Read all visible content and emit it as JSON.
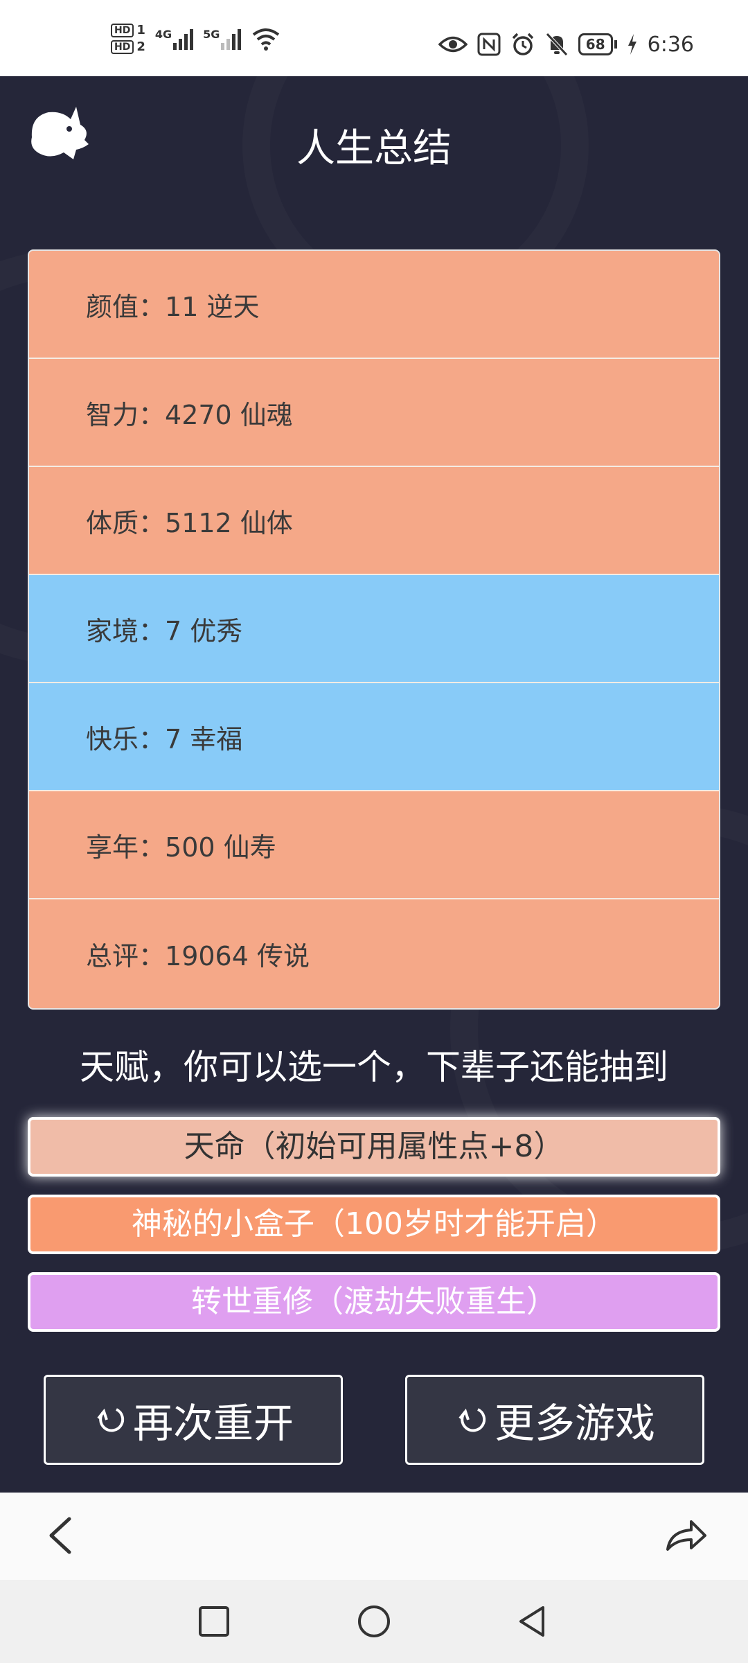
{
  "status_bar": {
    "sim1": "HD",
    "sim1_slot": "1",
    "sim2": "HD",
    "sim2_slot": "2",
    "network1": "4G",
    "network2": "5G",
    "battery": "68",
    "time": "6:36",
    "icons": [
      "hd-sim-icon",
      "signal-icon",
      "wifi-icon",
      "eye-icon",
      "nfc-icon",
      "alarm-icon",
      "mute-icon",
      "battery-icon",
      "charging-icon"
    ]
  },
  "header": {
    "title": "人生总结",
    "logo_icon": "cat-logo-icon"
  },
  "stats": [
    {
      "label": "颜值：",
      "value": "11 逆天",
      "color": "#f5a888"
    },
    {
      "label": "智力：",
      "value": "4270 仙魂",
      "color": "#f5a888"
    },
    {
      "label": "体质：",
      "value": "5112 仙体",
      "color": "#f5a888"
    },
    {
      "label": "家境：",
      "value": "7 优秀",
      "color": "#88cbf8"
    },
    {
      "label": "快乐：",
      "value": "7 幸福",
      "color": "#88cbf8"
    },
    {
      "label": "享年：",
      "value": "500 仙寿",
      "color": "#f5a888"
    },
    {
      "label": "总评：",
      "value": "19064 传说",
      "color": "#f5a888"
    }
  ],
  "talents": {
    "heading": "天赋，你可以选一个，下辈子还能抽到",
    "items": [
      {
        "label": "天命（初始可用属性点+8）",
        "selected": true
      },
      {
        "label": "神秘的小盒子（100岁时才能开启）",
        "selected": false
      },
      {
        "label": "转世重修（渡劫失败重生）",
        "selected": false
      }
    ]
  },
  "actions": {
    "restart_label": "再次重开",
    "more_games_label": "更多游戏",
    "icon": "refresh-icon"
  },
  "toolbar": {
    "back_icon": "chevron-left-icon",
    "share_icon": "share-icon"
  },
  "system_nav": {
    "recent_icon": "square-icon",
    "home_icon": "circle-icon",
    "back_icon": "triangle-back-icon"
  },
  "colors": {
    "background": "#252639",
    "stat_orange": "#f5a888",
    "stat_blue": "#88cbf8",
    "talent_selected": "#f0bca8",
    "talent_orange": "#f99a70",
    "talent_purple": "#df9ff0"
  }
}
